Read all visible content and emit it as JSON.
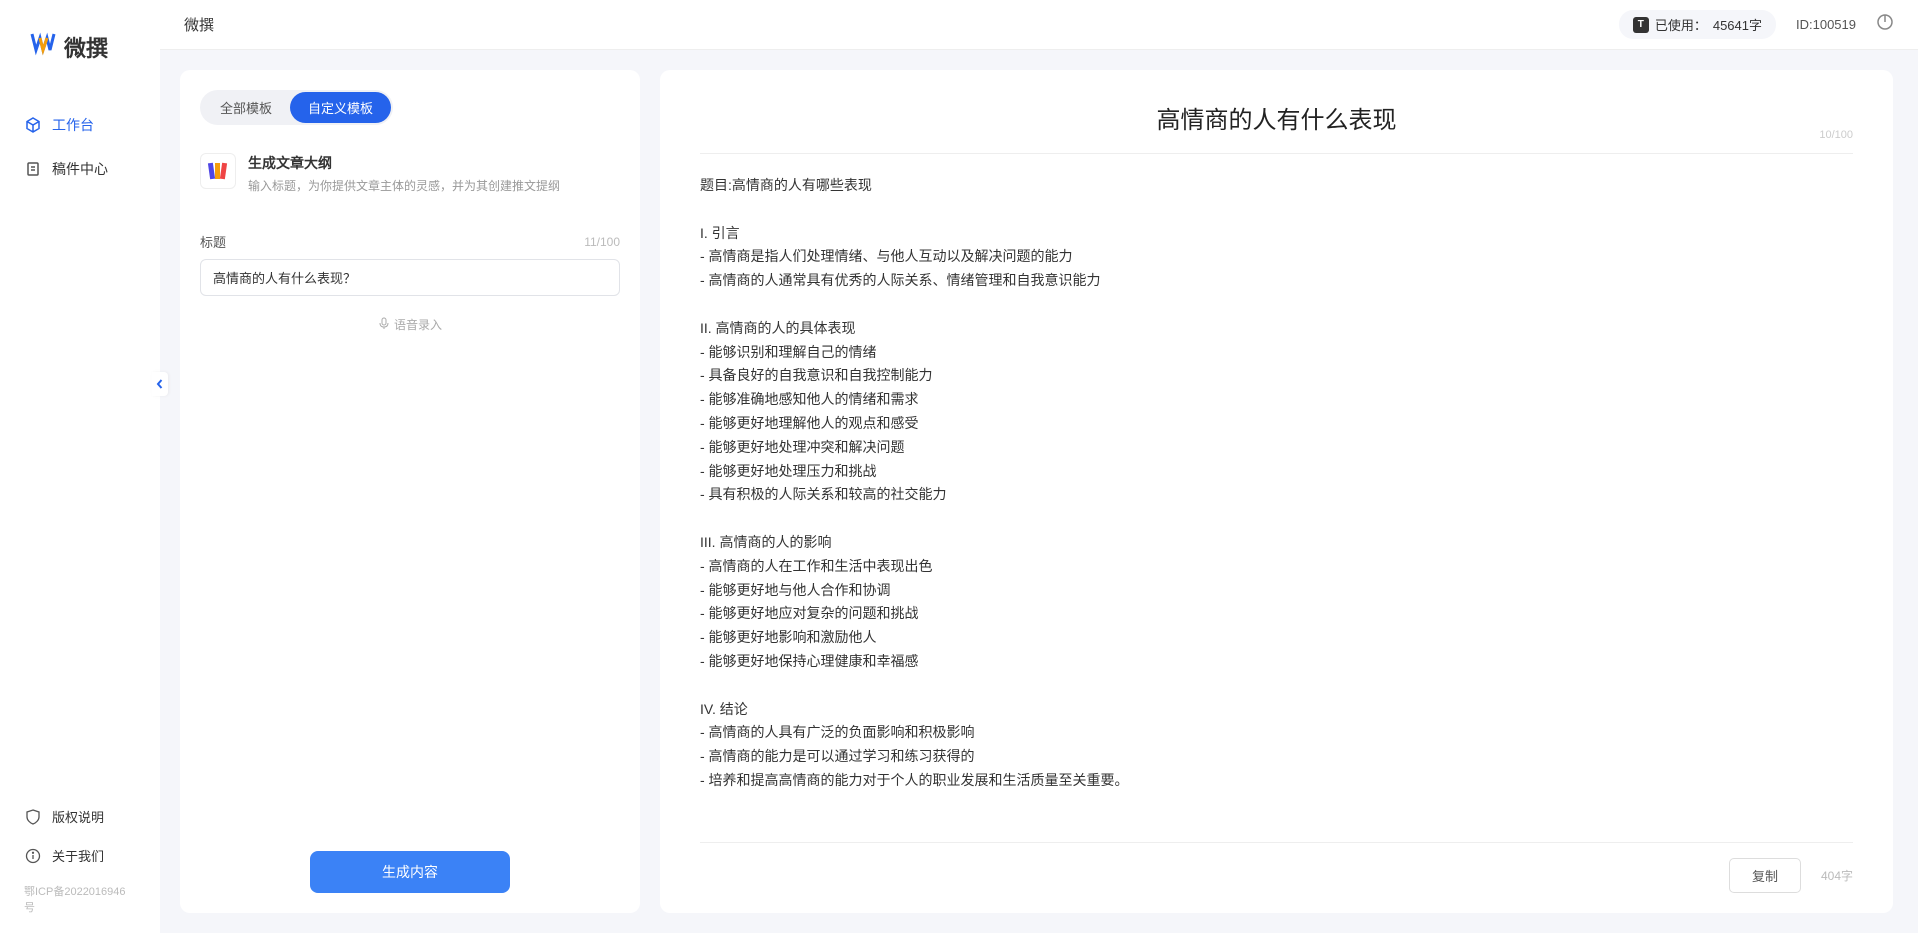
{
  "app": {
    "name": "微撰",
    "logo_w": "W"
  },
  "sidebar": {
    "nav": [
      {
        "label": "工作台",
        "active": true
      },
      {
        "label": "稿件中心",
        "active": false
      }
    ],
    "footer": [
      {
        "label": "版权说明"
      },
      {
        "label": "关于我们"
      }
    ],
    "icp": "鄂ICP备2022016946号"
  },
  "header": {
    "title": "微撰",
    "usage_prefix": "已使用：",
    "usage_value": "45641字",
    "user_id": "ID:100519"
  },
  "left_panel": {
    "tabs": [
      {
        "label": "全部模板",
        "active": false
      },
      {
        "label": "自定义模板",
        "active": true
      }
    ],
    "template": {
      "icon": "📚",
      "title": "生成文章大纲",
      "desc": "输入标题，为你提供文章主体的灵感，并为其创建推文提纲"
    },
    "form": {
      "label": "标题",
      "char_count": "11/100",
      "value": "高情商的人有什么表现？"
    },
    "voice_label": "语音录入",
    "generate_btn": "生成内容"
  },
  "right_panel": {
    "title": "高情商的人有什么表现",
    "title_count": "10/100",
    "body": "题目:高情商的人有哪些表现\n\nI. 引言\n- 高情商是指人们处理情绪、与他人互动以及解决问题的能力\n- 高情商的人通常具有优秀的人际关系、情绪管理和自我意识能力\n\nII. 高情商的人的具体表现\n- 能够识别和理解自己的情绪\n- 具备良好的自我意识和自我控制能力\n- 能够准确地感知他人的情绪和需求\n- 能够更好地理解他人的观点和感受\n- 能够更好地处理冲突和解决问题\n- 能够更好地处理压力和挑战\n- 具有积极的人际关系和较高的社交能力\n\nIII. 高情商的人的影响\n- 高情商的人在工作和生活中表现出色\n- 能够更好地与他人合作和协调\n- 能够更好地应对复杂的问题和挑战\n- 能够更好地影响和激励他人\n- 能够更好地保持心理健康和幸福感\n\nIV. 结论\n- 高情商的人具有广泛的负面影响和积极影响\n- 高情商的能力是可以通过学习和练习获得的\n- 培养和提高高情商的能力对于个人的职业发展和生活质量至关重要。",
    "copy_btn": "复制",
    "word_count": "404字"
  }
}
